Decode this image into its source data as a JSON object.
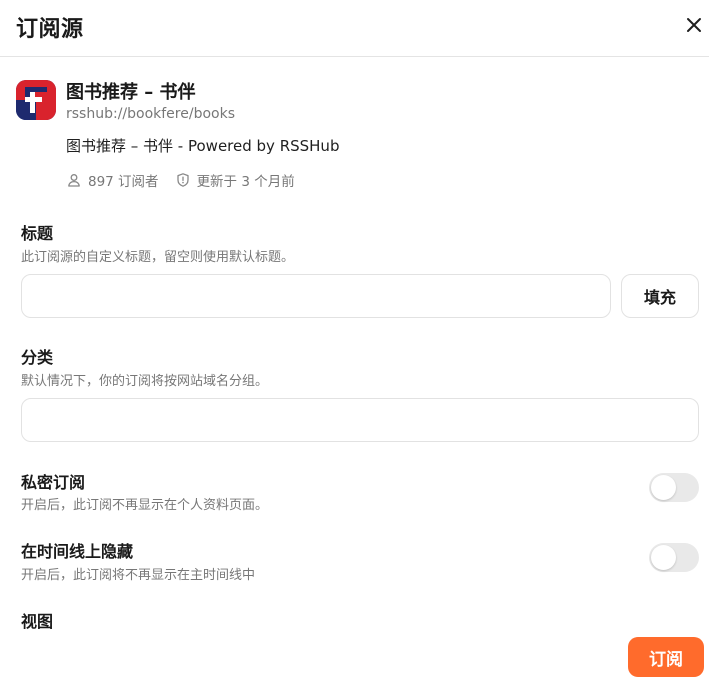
{
  "dialog": {
    "title": "订阅源"
  },
  "feed": {
    "name": "图书推荐 – 书伴",
    "url": "rsshub://bookfere/books",
    "description": "图书推荐 – 书伴 - Powered by RSSHub",
    "subscriber_count": "897 订阅者",
    "updated": "更新于 3 个月前"
  },
  "form": {
    "title_label": "标题",
    "title_hint": "此订阅源的自定义标题，留空则使用默认标题。",
    "title_value": "",
    "fill_button": "填充",
    "category_label": "分类",
    "category_hint": "默认情况下，你的订阅将按网站域名分组。",
    "category_value": "",
    "private_label": "私密订阅",
    "private_hint": "开启后，此订阅不再显示在个人资料页面。",
    "private_enabled": false,
    "hide_label": "在时间线上隐藏",
    "hide_hint": "开启后，此订阅将不再显示在主时间线中",
    "hide_enabled": false,
    "view_label": "视图",
    "submit_button": "订阅"
  },
  "colors": {
    "accent": "#ff6b2c",
    "avatar_primary": "#d9232d",
    "avatar_secondary": "#2b3a8c"
  },
  "icons": {
    "close": "close-icon",
    "subscribers": "user-icon",
    "updated": "shield-clock-icon"
  }
}
